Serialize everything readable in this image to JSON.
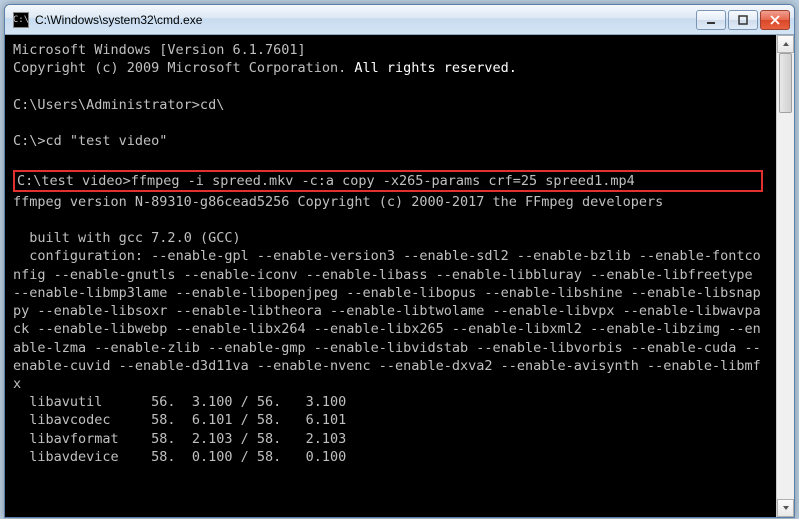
{
  "window": {
    "title": "C:\\Windows\\system32\\cmd.exe",
    "icon_label": "C:\\"
  },
  "terminal": {
    "header1": "Microsoft Windows [Version 6.1.7601]",
    "header2": "Copyright (c) 2009 Microsoft Corporation.",
    "header2b": " All rights reserved.",
    "blank": "",
    "line_cd1": "C:\\Users\\Administrator>cd\\",
    "line_cd2": "C:\\>cd \"test video\"",
    "line_ffmpeg_cmd": "C:\\test video>ffmpeg -i spreed.mkv -c:a copy -x265-params crf=25 spreed1.mp4",
    "line_ffmpeg_ver": "ffmpeg version N-89310-g86cead5256 Copyright (c) 2000-2017 the FFmpeg developers",
    "line_gcc": "  built with gcc 7.2.0 (GCC)",
    "config_text": "  configuration: --enable-gpl --enable-version3 --enable-sdl2 --enable-bzlib --enable-fontconfig --enable-gnutls --enable-iconv --enable-libass --enable-libbluray --enable-libfreetype --enable-libmp3lame --enable-libopenjpeg --enable-libopus --enable-libshine --enable-libsnappy --enable-libsoxr --enable-libtheora --enable-libtwolame --enable-libvpx --enable-libwavpack --enable-libwebp --enable-libx264 --enable-libx265 --enable-libxml2 --enable-libzimg --enable-lzma --enable-zlib --enable-gmp --enable-libvidstab --enable-libvorbis --enable-cuda --enable-cuvid --enable-d3d11va --enable-nvenc --enable-dxva2 --enable-avisynth --enable-libmfx",
    "libs": [
      {
        "name": "libavutil",
        "v1": "56.",
        "v2": "3.100",
        "v3": "56.",
        "v4": "3.100"
      },
      {
        "name": "libavcodec",
        "v1": "58.",
        "v2": "6.101",
        "v3": "58.",
        "v4": "6.101"
      },
      {
        "name": "libavformat",
        "v1": "58.",
        "v2": "2.103",
        "v3": "58.",
        "v4": "2.103"
      },
      {
        "name": "libavdevice",
        "v1": "58.",
        "v2": "0.100",
        "v3": "58.",
        "v4": "0.100"
      }
    ]
  },
  "colors": {
    "highlight_border": "#e03030",
    "terminal_bg": "#000000",
    "terminal_fg": "#e0e0e0"
  }
}
